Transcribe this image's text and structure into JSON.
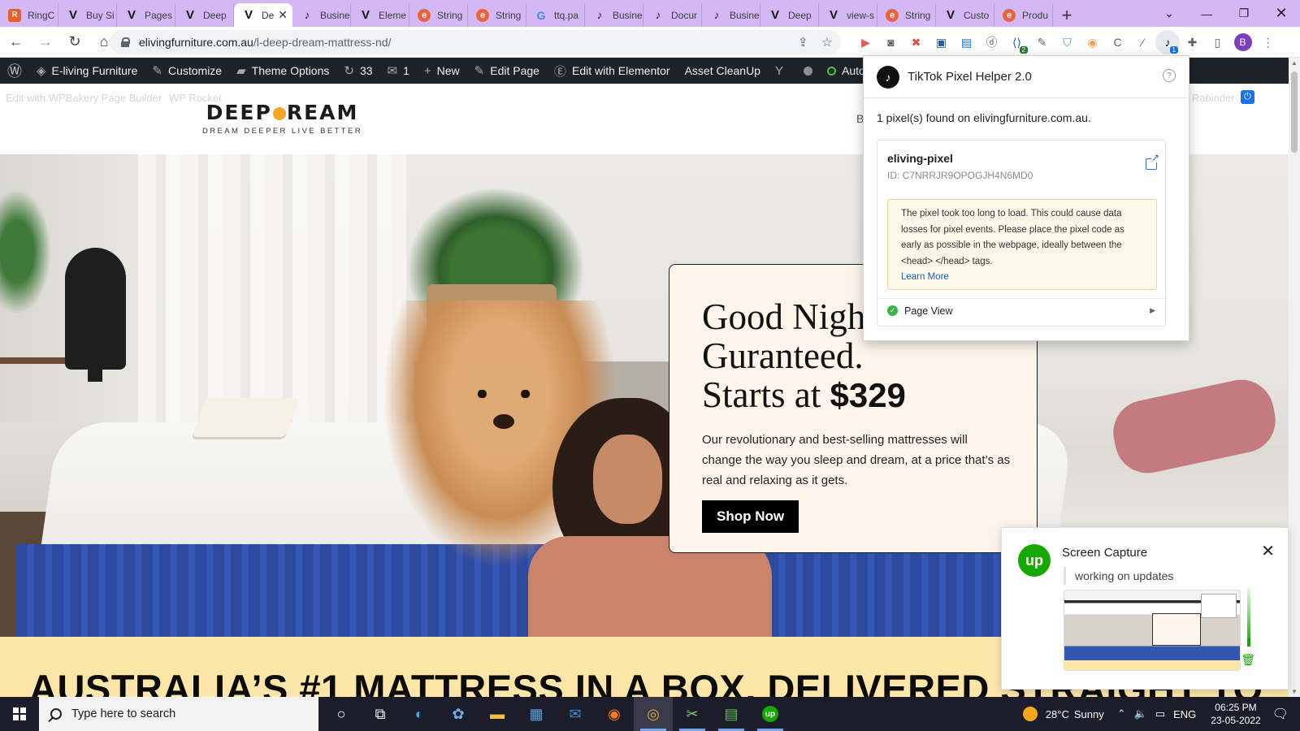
{
  "browser": {
    "tabs": [
      {
        "label": "RingC",
        "icon": "ringcentral-icon",
        "fav": "R",
        "kind": "rc"
      },
      {
        "label": "Buy Si",
        "icon": "v-icon",
        "fav": "V",
        "kind": "v"
      },
      {
        "label": "Pages",
        "icon": "v-icon",
        "fav": "V",
        "kind": "v"
      },
      {
        "label": "Deep",
        "icon": "v-icon",
        "fav": "V",
        "kind": "v"
      },
      {
        "label": "De",
        "icon": "v-icon",
        "fav": "V",
        "kind": "v",
        "active": true
      },
      {
        "label": "Busine",
        "icon": "tiktok-icon",
        "fav": "♪",
        "kind": "tt"
      },
      {
        "label": "Eleme",
        "icon": "v-icon",
        "fav": "V",
        "kind": "v"
      },
      {
        "label": "String",
        "icon": "e-icon",
        "fav": "e",
        "kind": "e"
      },
      {
        "label": "String",
        "icon": "e-icon",
        "fav": "e",
        "kind": "e"
      },
      {
        "label": "ttq.pa",
        "icon": "google-icon",
        "fav": "G",
        "kind": "g"
      },
      {
        "label": "Busine",
        "icon": "tiktok-icon",
        "fav": "♪",
        "kind": "tt"
      },
      {
        "label": "Docur",
        "icon": "tiktok-icon",
        "fav": "♪",
        "kind": "tt"
      },
      {
        "label": "Busine",
        "icon": "tiktok-icon",
        "fav": "♪",
        "kind": "tt"
      },
      {
        "label": "Deep",
        "icon": "v-icon",
        "fav": "V",
        "kind": "v"
      },
      {
        "label": "view-s",
        "icon": "v-icon",
        "fav": "V",
        "kind": "v"
      },
      {
        "label": "String",
        "icon": "e-icon",
        "fav": "e",
        "kind": "e"
      },
      {
        "label": "Custo",
        "icon": "v-icon",
        "fav": "V",
        "kind": "v"
      },
      {
        "label": "Produ",
        "icon": "e-icon",
        "fav": "e",
        "kind": "e"
      }
    ],
    "url_host": "elivingfurniture.com.au",
    "url_path": "/l-deep-dream-mattress-nd/",
    "profile_initial": "B",
    "ext_badges": {
      "ext_a": "2",
      "tiktok": "1"
    },
    "tab_strip_color": "#d4b8f5"
  },
  "wpbar": {
    "items": [
      {
        "label": "E-living Furniture",
        "icon": "palette-icon"
      },
      {
        "label": "Customize",
        "icon": "brush-icon"
      },
      {
        "label": "Theme Options",
        "icon": "folder-icon"
      },
      {
        "label": "33",
        "icon": "refresh-icon"
      },
      {
        "label": "1",
        "icon": "comment-icon"
      },
      {
        "label": "New",
        "icon": "plus-icon"
      },
      {
        "label": "Edit Page",
        "icon": "pencil-icon"
      },
      {
        "label": "Edit with Elementor",
        "icon": "elementor-icon"
      },
      {
        "label": "Asset CleanUp",
        "icon": ""
      }
    ],
    "autoptimize": "Autoptimiz",
    "faint_left1": "Edit with WPBakery Page Builder",
    "faint_left2": "WP Rocket",
    "faint_right": "Rabinder"
  },
  "site": {
    "logo_main_a": "DEEP",
    "logo_main_b": "REAM",
    "logo_sub": "DREAM DEEPER LIVE BETTER",
    "nav_partial": "B",
    "hero_line1": "Good Nigh",
    "hero_line2": "Guranteed.",
    "hero_line3_a": "Starts at ",
    "hero_price": "$329",
    "hero_desc": "Our revolutionary and best-selling mattresses will change the way you sleep and dream, at a price that’s as real and relaxing as it gets.",
    "shop_button": "Shop Now",
    "banner": "AUSTRALIA’S #1 MATTRESS IN A BOX, DELIVERED STRAIGHT TO"
  },
  "tiktok": {
    "title": "TikTok Pixel Helper 2.0",
    "found": "1 pixel(s) found on elivingfurniture.com.au.",
    "pixel_name": "eliving-pixel",
    "pixel_id": "ID:  C7NRRJR9OPOGJH4N6MD0",
    "warning": "The pixel took too long to load. This could cause data losses for pixel events. Please place the pixel code as early as possible in the webpage, ideally between the <head> </head> tags.",
    "learn_more": "Learn More",
    "event": "Page View"
  },
  "upwork": {
    "title": "Screen Capture",
    "message": "working on updates",
    "brand_color": "#14a800"
  },
  "taskbar": {
    "search_placeholder": "Type here to search",
    "weather_temp": "28°C",
    "weather_desc": "Sunny",
    "lang": "ENG",
    "time": "06:25 PM",
    "date": "23-05-2022"
  }
}
